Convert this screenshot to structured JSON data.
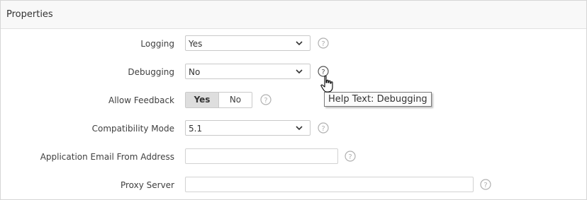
{
  "panel": {
    "title": "Properties"
  },
  "fields": {
    "logging": {
      "label": "Logging",
      "value": "Yes"
    },
    "debugging": {
      "label": "Debugging",
      "value": "No"
    },
    "allow_feedback": {
      "label": "Allow Feedback",
      "options": [
        "Yes",
        "No"
      ],
      "selected": "Yes"
    },
    "compatibility_mode": {
      "label": "Compatibility Mode",
      "value": "5.1"
    },
    "email_from": {
      "label": "Application Email From Address",
      "value": ""
    },
    "proxy_server": {
      "label": "Proxy Server",
      "value": ""
    }
  },
  "tooltip": {
    "text": "Help Text: Debugging"
  },
  "icons": {
    "help": "question-circle-icon",
    "dropdown": "chevron-down-icon",
    "cursor": "hand-pointer-icon"
  },
  "colors": {
    "border": "#c9c9c9",
    "header_bg": "#f8f8f8",
    "toggle_active_bg": "#dedede",
    "help_icon": "#b0b0b0"
  }
}
